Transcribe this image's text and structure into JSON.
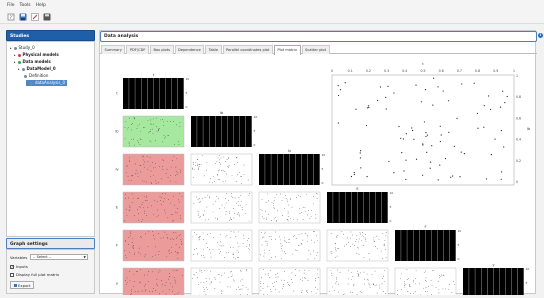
{
  "menu": {
    "file": "File",
    "tools": "Tools",
    "help": "Help"
  },
  "toolbar": {
    "icons": [
      "new-study-icon",
      "save-icon",
      "edit-icon",
      "save-all-icon"
    ]
  },
  "studies": {
    "title": "Studies",
    "tree": [
      {
        "label": "Study_0",
        "level": 0,
        "icon": "study-icon"
      },
      {
        "label": "Physical models",
        "level": 1,
        "icon": "physical-models-icon",
        "color": "#d83c3c"
      },
      {
        "label": "Data models",
        "level": 1,
        "icon": "data-models-icon",
        "color": "#3aa64a"
      },
      {
        "label": "DataModel_0",
        "level": 2,
        "icon": "data-model-icon"
      },
      {
        "label": "Definition",
        "level": 3,
        "icon": "definition-icon"
      },
      {
        "label": "dataAnalysis_0",
        "level": 4,
        "icon": "analysis-icon",
        "selected": true
      }
    ]
  },
  "graph_settings": {
    "title": "Graph settings",
    "variables_label": "Variables",
    "variables_value": "-- Select --",
    "inputs_label": "Inputs",
    "inputs_checked": true,
    "display_label": "Display full plot matrix",
    "display_checked": false,
    "export_label": "Export"
  },
  "main": {
    "title": "Data analysis",
    "tabs": [
      "Summary",
      "PDF/CDF",
      "Box plots",
      "Dependence",
      "Table",
      "Parallel coordinates plot",
      "Plot matrix",
      "Scatter plot"
    ],
    "active_tab": 6
  },
  "colors": {
    "accent": "#1f5fa8",
    "green": "#a7e8a0",
    "red": "#ec9b9b",
    "bar": "#000000"
  },
  "chart_data": {
    "type": "scatter-matrix",
    "variables": [
      "t",
      "Ib",
      "Iv",
      "E",
      "F",
      "y"
    ],
    "axis_ticks_top": [
      "0",
      "0.1",
      "0.2",
      "0.3",
      "0.4",
      "0.5",
      "0.6",
      "0.7",
      "0.8",
      "0.9",
      "1"
    ],
    "axis_ticks_right": [
      "1",
      "0.8",
      "0.6",
      "0.4",
      "0.2",
      "0"
    ],
    "hist_ticks": [
      "10",
      "5",
      "0"
    ],
    "highlight_colors": {
      "1": "#a7e8a0",
      "2": "#ec9b9b",
      "3": "#ec9b9b",
      "4": "#ec9b9b",
      "5": "#ec9b9b"
    }
  }
}
